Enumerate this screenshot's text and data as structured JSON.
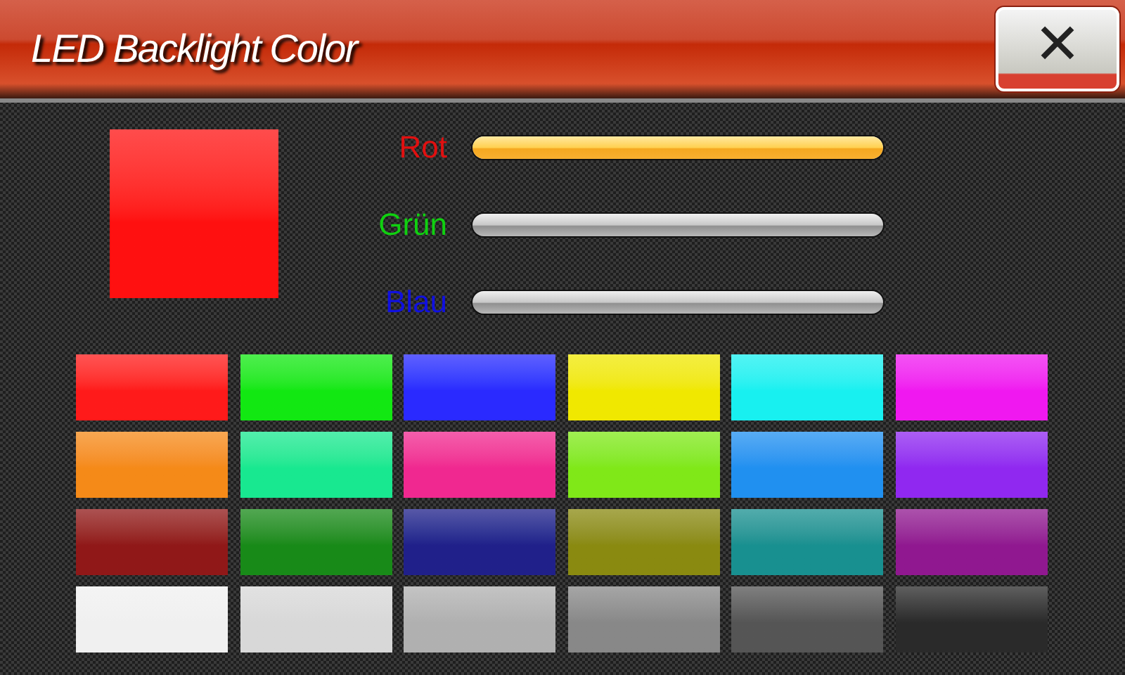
{
  "header": {
    "title": "LED Backlight Color",
    "close": "✕"
  },
  "preview": {
    "color": "#ff1010"
  },
  "sliders": [
    {
      "label": "Rot",
      "color": "#e01010",
      "level": 1
    },
    {
      "label": "Grün",
      "color": "#10d010",
      "level": 0
    },
    {
      "label": "Blau",
      "color": "#1010e0",
      "level": 0
    }
  ],
  "swatches": [
    {
      "color": "#ff1a1a"
    },
    {
      "color": "#12e812"
    },
    {
      "color": "#2a2aff"
    },
    {
      "color": "#f0e800"
    },
    {
      "color": "#18f0f0"
    },
    {
      "color": "#f018f0"
    },
    {
      "color": "#f58a18"
    },
    {
      "color": "#18e890"
    },
    {
      "color": "#f02890"
    },
    {
      "color": "#80e818"
    },
    {
      "color": "#2090f0"
    },
    {
      "color": "#9028f0"
    },
    {
      "color": "#901818"
    },
    {
      "color": "#188a18"
    },
    {
      "color": "#20208a"
    },
    {
      "color": "#8a8a10"
    },
    {
      "color": "#189090"
    },
    {
      "color": "#901890"
    },
    {
      "color": "#f0f0f0"
    },
    {
      "color": "#d8d8d8"
    },
    {
      "color": "#b0b0b0"
    },
    {
      "color": "#888888"
    },
    {
      "color": "#555555"
    },
    {
      "color": "#2a2a2a"
    }
  ]
}
